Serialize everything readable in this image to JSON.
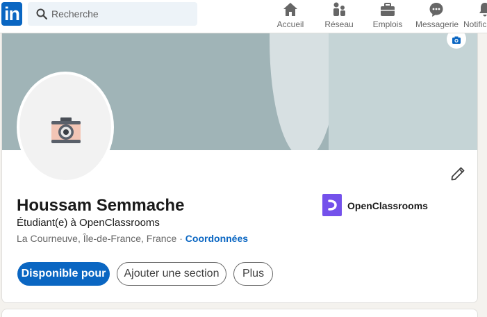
{
  "topbar": {
    "logo_text": "in",
    "search": {
      "placeholder": "Recherche"
    },
    "nav": [
      {
        "label": "Accueil",
        "icon": "home-icon"
      },
      {
        "label": "Réseau",
        "icon": "network-icon"
      },
      {
        "label": "Emplois",
        "icon": "briefcase-icon"
      },
      {
        "label": "Messagerie",
        "icon": "messaging-icon"
      },
      {
        "label": "Notifications",
        "icon": "bell-icon"
      }
    ]
  },
  "profile": {
    "name": "Houssam Semmache",
    "headline": "Étudiant(e) à OpenClassrooms",
    "location": "La Courneuve, Île-de-France, France",
    "separator": " · ",
    "contact_link": "Coordonnées",
    "company": {
      "name": "OpenClassrooms",
      "color": "#7451eb"
    },
    "buttons": {
      "primary": "Disponible pour",
      "add_section": "Ajouter une section",
      "more": "Plus"
    }
  },
  "colors": {
    "accent": "#0a66c2",
    "banner": "#a0b4b7"
  }
}
